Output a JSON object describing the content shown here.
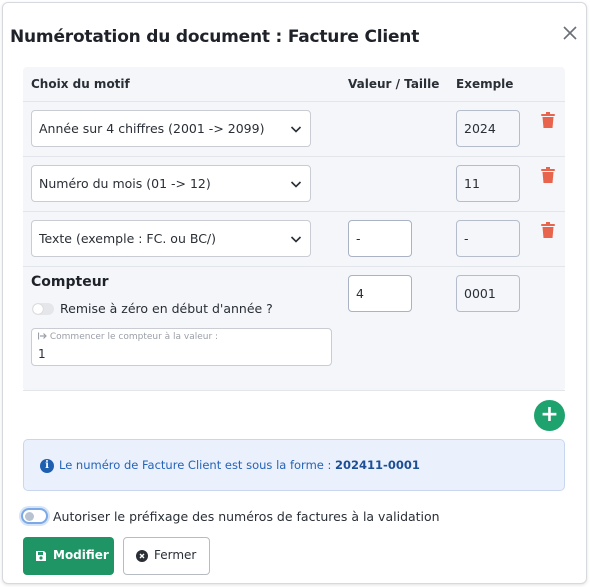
{
  "dialog": {
    "title": "Numérotation du document : Facture Client",
    "close_icon": "close-icon"
  },
  "table": {
    "headers": {
      "motif": "Choix du motif",
      "valeur": "Valeur / Taille",
      "exemple": "Exemple"
    },
    "rows": [
      {
        "motif": "Année sur 4 chiffres (2001 -> 2099)",
        "valeur": "",
        "exemple": "2024"
      },
      {
        "motif": "Numéro du mois (01 -> 12)",
        "valeur": "",
        "exemple": "11"
      },
      {
        "motif": "Texte (exemple : FC. ou BC/)",
        "valeur": "-",
        "exemple": "-"
      }
    ]
  },
  "compteur": {
    "title": "Compteur",
    "reset_label": "Remise à zéro en début d'année ?",
    "reset_enabled": false,
    "size_value": "4",
    "example": "0001",
    "start_label": "Commencer le compteur à la valeur :",
    "start_value": "1"
  },
  "info": {
    "prefix_text": "Le numéro de Facture Client est sous la forme :",
    "number": "202411-0001"
  },
  "prefix_toggle": {
    "label": "Autoriser le préfixage des numéros de factures à la validation",
    "enabled": false
  },
  "buttons": {
    "save": "Modifier",
    "cancel": "Fermer"
  },
  "colors": {
    "primary": "#1f9565",
    "add_button": "#1fa36e",
    "delete": "#e8644c",
    "info_text": "#2563b8"
  }
}
